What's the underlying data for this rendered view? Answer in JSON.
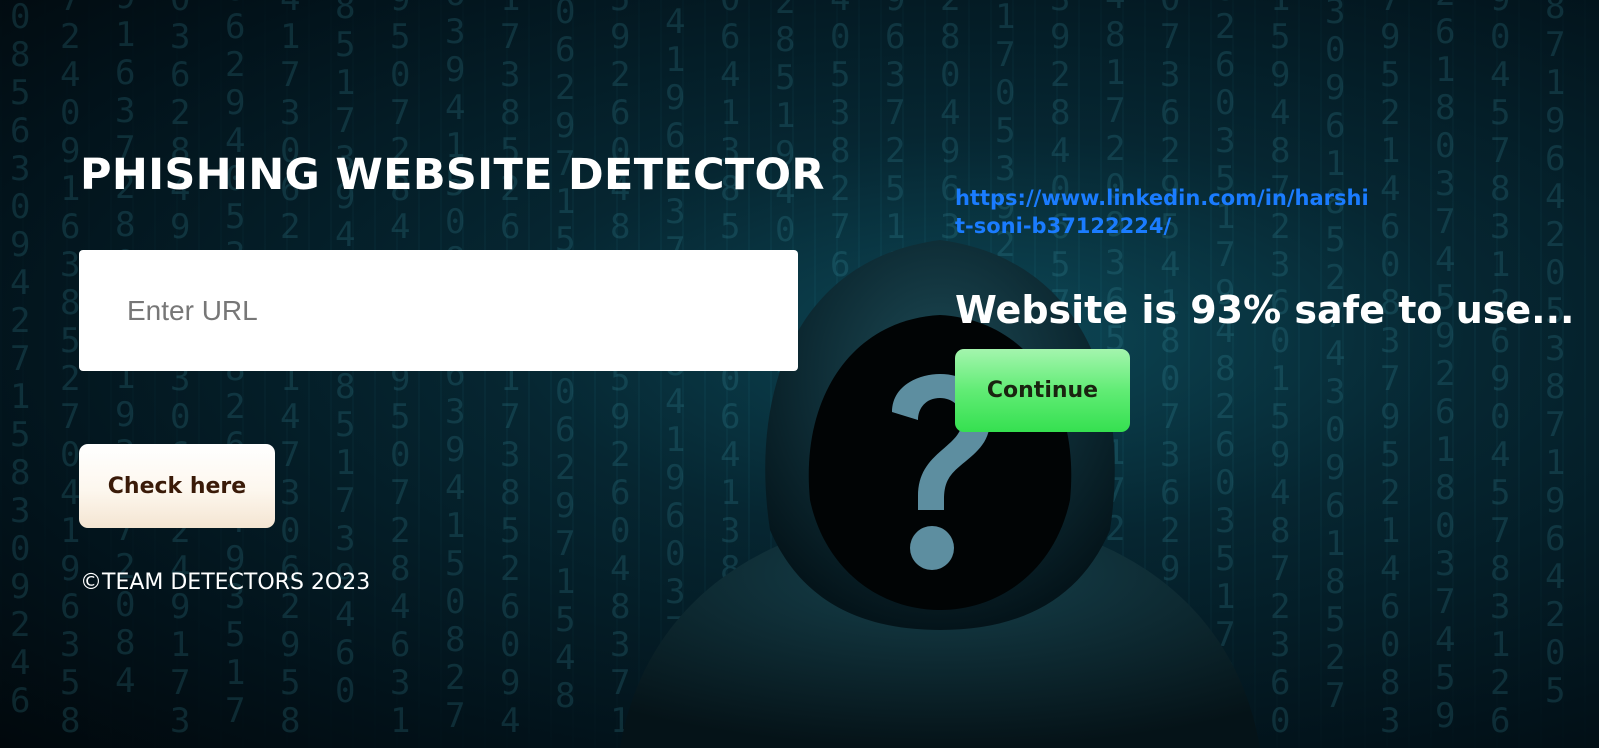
{
  "header": {
    "title": "PHISHING WEBSITE DETECTOR"
  },
  "form": {
    "url_placeholder": "Enter URL",
    "url_value": "",
    "check_label": "Check here"
  },
  "footer": {
    "copyright": "©TEAM DETECTORS 2O23"
  },
  "result": {
    "profile_link": "https://www.linkedin.com/in/harshit-soni-b37122224/",
    "message": "Website is 93% safe to use...",
    "safety_percent": 93,
    "continue_label": "Continue"
  },
  "colors": {
    "link": "#1a7cff",
    "continue_button": "#4fe866",
    "check_button": "#fdf3e6",
    "title_text": "#ffffff"
  },
  "background": {
    "icons": [
      "hooded-hacker-icon",
      "question-mark-icon",
      "binary-digits-rain"
    ]
  }
}
